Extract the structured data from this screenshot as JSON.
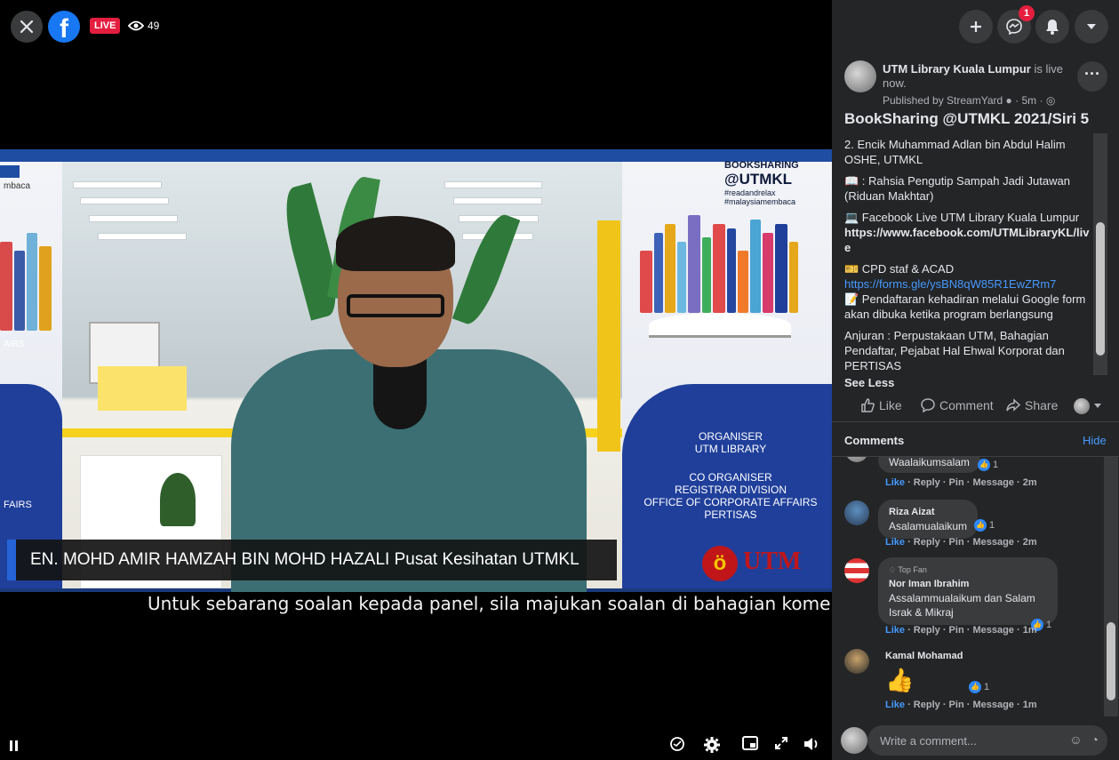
{
  "player": {
    "live_label": "LIVE",
    "viewer_count": "49",
    "lower_third": "EN. MOHD AMIR HAMZAH BIN MOHD HAZALI Pusat Kesihatan UTMKL",
    "ticker": "Untuk sebarang soalan kepada panel, sila majukan soalan di bahagian komen dan ak",
    "banner": {
      "logo_line1": "BOOKSHARING",
      "logo_line2": "@UTMKL",
      "logo_line3": "#readandrelax",
      "logo_line4": "#malaysiamembaca",
      "organiser_label": "ORGANISER",
      "organiser": "UTM LIBRARY",
      "co_organiser_label": "CO ORGANISER",
      "co_org_1": "REGISTRAR DIVISION",
      "co_org_2": "OFFICE OF CORPORATE AFFAIRS",
      "co_org_3": "PERTISAS",
      "left_partial_1": "FAIRS",
      "left_partial_2": "AIRS",
      "left_partial_3": "mbaca",
      "utm_text": "UTM"
    }
  },
  "header": {
    "notification_count": "1"
  },
  "post": {
    "page_name": "UTM Library Kuala Lumpur",
    "status": " is live now.",
    "published": "Published by StreamYard",
    "time": "· 5m ·",
    "title": "BookSharing @UTMKL 2021/Siri 5",
    "body": {
      "p1": "2. Encik Muhammad Adlan bin Abdul Halim OSHE, UTMKL",
      "p2": "📖 : Rahsia Pengutip Sampah Jadi Jutawan (Riduan Makhtar)",
      "p3a": "💻 Facebook Live UTM Library Kuala Lumpur",
      "p3b": "https://www.facebook.com/UTMLibraryKL/live",
      "p4a": "🎫 CPD staf & ACAD",
      "p4b": "https://forms.gle/ysBN8qW85R1EwZRm7",
      "p5": "📝 Pendaftaran kehadiran melalui Google form akan dibuka ketika program berlangsung",
      "p6": "Anjuran : Perpustakaan UTM, Bahagian Pendaftar, Pejabat Hal Ehwal Korporat dan PERTISAS"
    },
    "see_less": "See Less",
    "actions": {
      "like": "Like",
      "comment": "Comment",
      "share": "Share"
    }
  },
  "comments": {
    "heading": "Comments",
    "hide": "Hide",
    "write_placeholder": "Write a comment...",
    "items": [
      {
        "name": "",
        "text": "Waalaikumsalam",
        "reactions": "1",
        "like": "Like",
        "reply": "Reply",
        "pin": "Pin",
        "message": "Message",
        "time": "2m"
      },
      {
        "name": "Riza Aizat",
        "text": "Asalamualaikum",
        "reactions": "1",
        "like": "Like",
        "reply": "Reply",
        "pin": "Pin",
        "message": "Message",
        "time": "2m"
      },
      {
        "badge": "Top Fan",
        "name": "Nor Iman Ibrahim",
        "text": "Assalammualaikum dan Salam Israk & Mikraj",
        "reactions": "1",
        "like": "Like",
        "reply": "Reply",
        "pin": "Pin",
        "message": "Message",
        "time": "1m"
      },
      {
        "name": "Kamal Mohamad",
        "text": "👍",
        "reactions": "1",
        "like": "Like",
        "reply": "Reply",
        "pin": "Pin",
        "message": "Message",
        "time": "1m"
      }
    ]
  },
  "colors": {
    "facebook_blue": "#1877f2",
    "live_red": "#e41e3f",
    "sidebar_bg": "#242526",
    "link_blue": "#4599ff",
    "lower_third_accent": "#2563d6"
  }
}
